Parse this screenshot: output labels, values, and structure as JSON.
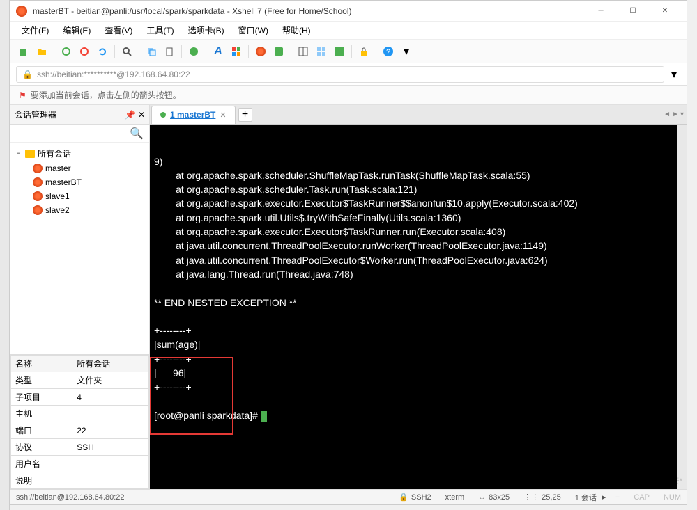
{
  "window": {
    "title": "masterBT - beitian@panli:/usr/local/spark/sparkdata - Xshell 7 (Free for Home/School)",
    "minimize": "─",
    "maximize": "☐",
    "close": "✕"
  },
  "menubar": [
    "文件(F)",
    "编辑(E)",
    "查看(V)",
    "工具(T)",
    "选项卡(B)",
    "窗口(W)",
    "帮助(H)"
  ],
  "addressbar": {
    "url": "ssh://beitian:**********@192.168.64.80:22"
  },
  "hint": "要添加当前会话，点击左侧的箭头按钮。",
  "sidebar": {
    "title": "会话管理器",
    "root": "所有会话",
    "sessions": [
      "master",
      "masterBT",
      "slave1",
      "slave2"
    ]
  },
  "props": {
    "headers": [
      "名称",
      "所有会话"
    ],
    "rows": [
      [
        "类型",
        "文件夹"
      ],
      [
        "子项目",
        "4"
      ],
      [
        "主机",
        ""
      ],
      [
        "端口",
        "22"
      ],
      [
        "协议",
        "SSH"
      ],
      [
        "用户名",
        ""
      ],
      [
        "说明",
        ""
      ]
    ]
  },
  "tabs": {
    "active": "1 masterBT",
    "add": "+"
  },
  "terminal": {
    "lines": [
      "9)",
      "        at org.apache.spark.scheduler.ShuffleMapTask.runTask(ShuffleMapTask.scala:55)",
      "        at org.apache.spark.scheduler.Task.run(Task.scala:121)",
      "        at org.apache.spark.executor.Executor$TaskRunner$$anonfun$10.apply(Executor.scala:402)",
      "        at org.apache.spark.util.Utils$.tryWithSafeFinally(Utils.scala:1360)",
      "        at org.apache.spark.executor.Executor$TaskRunner.run(Executor.scala:408)",
      "        at java.util.concurrent.ThreadPoolExecutor.runWorker(ThreadPoolExecutor.java:1149)",
      "        at java.util.concurrent.ThreadPoolExecutor$Worker.run(ThreadPoolExecutor.java:624)",
      "        at java.lang.Thread.run(Thread.java:748)",
      "",
      "** END NESTED EXCEPTION **",
      "",
      "+--------+",
      "|sum(age)|",
      "+--------+",
      "|      96|",
      "+--------+",
      "",
      "[root@panli sparkdata]# "
    ]
  },
  "statusbar": {
    "conn": "ssh://beitian@192.168.64.80:22",
    "proto": "SSH2",
    "term": "xterm",
    "size": "83x25",
    "pos": "25,25",
    "sess": "1 会话",
    "caps": "CAP",
    "num": "NUM"
  },
  "watermark": "CSDN @北天*"
}
